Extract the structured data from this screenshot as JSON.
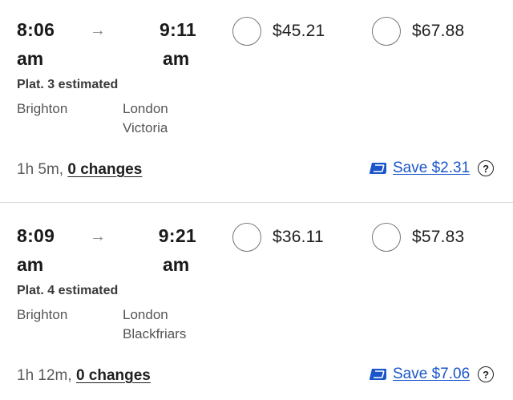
{
  "journeys": [
    {
      "departure_time": "8:06",
      "departure_ampm": "am",
      "arrival_time": "9:11",
      "arrival_ampm": "am",
      "arrow": "→",
      "platform": "Plat. 3 estimated",
      "from": "Brighton",
      "to_line1": "London",
      "to_line2": "Victoria",
      "fare_a": "$45.21",
      "fare_b": "$67.88",
      "duration": "1h 5m,",
      "changes": "0 changes",
      "save": "Save $2.31",
      "help": "?"
    },
    {
      "departure_time": "8:09",
      "departure_ampm": "am",
      "arrival_time": "9:21",
      "arrival_ampm": "am",
      "arrow": "→",
      "platform": "Plat. 4 estimated",
      "from": "Brighton",
      "to_line1": "London",
      "to_line2": "Blackfriars",
      "fare_a": "$36.11",
      "fare_b": "$57.83",
      "duration": "1h 12m,",
      "changes": "0 changes",
      "save": "Save $7.06",
      "help": "?"
    }
  ],
  "colors": {
    "link": "#1a56c9",
    "divider": "#d9d9d9"
  }
}
